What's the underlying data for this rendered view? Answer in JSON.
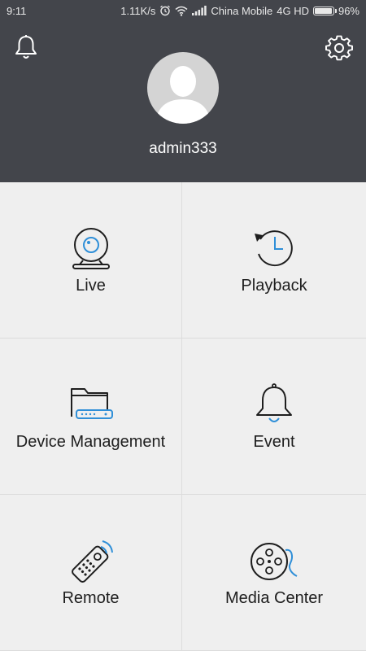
{
  "status_bar": {
    "time": "9:11",
    "speed": "1.11K/s",
    "carrier": "China Mobile",
    "network": "4G HD",
    "battery": "96%",
    "battery_level": 0.96
  },
  "header": {
    "username": "admin333",
    "background_color": "#43454b",
    "icons": {
      "notifications": "bell-icon",
      "settings": "gear-icon",
      "avatar": "user-avatar-icon"
    }
  },
  "menu": {
    "accent_color": "#2f8fd8",
    "tiles": [
      {
        "label": "Live",
        "icon": "webcam-icon"
      },
      {
        "label": "Playback",
        "icon": "history-clock-icon"
      },
      {
        "label": "Device Management",
        "icon": "folder-device-icon"
      },
      {
        "label": "Event",
        "icon": "event-bell-icon"
      },
      {
        "label": "Remote",
        "icon": "remote-control-icon"
      },
      {
        "label": "Media Center",
        "icon": "film-reel-icon"
      }
    ]
  }
}
